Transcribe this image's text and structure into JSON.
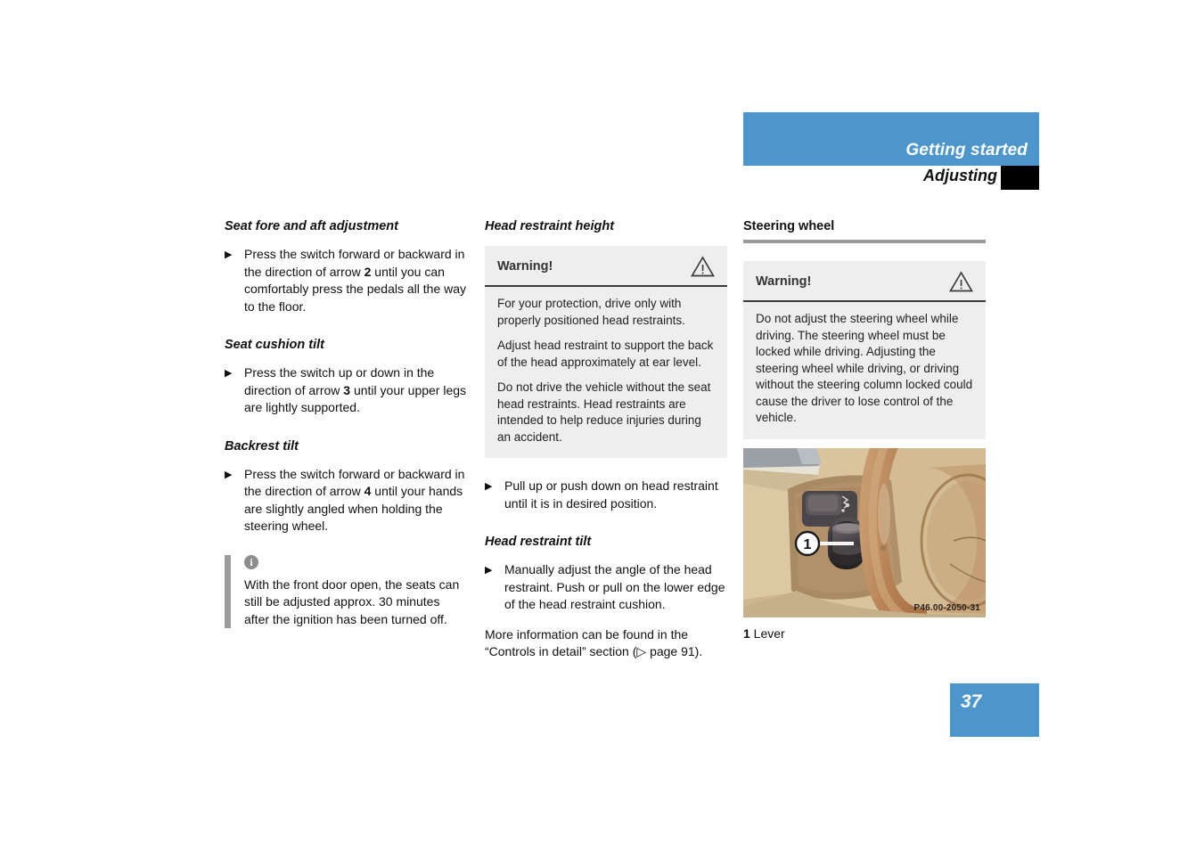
{
  "header": {
    "section_title": "Getting started",
    "subsection_title": "Adjusting"
  },
  "page_number": "37",
  "columns": {
    "left": {
      "heading_1": "Seat fore and aft adjustment",
      "bullet_1_pre": "Press the switch forward or backward in the direction of arrow ",
      "bullet_1_bold": "2",
      "bullet_1_post": " until you can comfortably press the pedals all the way to the floor.",
      "heading_2": "Seat cushion tilt",
      "bullet_2_pre": "Press the switch up or down in the direction of arrow ",
      "bullet_2_bold": "3",
      "bullet_2_post": " until your upper legs are lightly supported.",
      "heading_3": "Backrest tilt",
      "bullet_3_pre": "Press the switch forward or backward in the direction of arrow ",
      "bullet_3_bold": "4",
      "bullet_3_post": " until your hands are slightly angled when holding the steering wheel.",
      "note_icon": "info-icon",
      "note_text": "With the front door open, the seats can still be adjusted approx. 30 minutes after the ignition has been turned off."
    },
    "middle": {
      "heading_1": "Head restraint height",
      "warning": {
        "title": "Warning!",
        "icon": "warning-triangle-icon",
        "paragraph_1": "For your protection, drive only with properly positioned head restraints.",
        "paragraph_2": "Adjust head restraint to support the back of the head approximately at ear level.",
        "paragraph_3": "Do not drive the vehicle without the seat head restraints. Head restraints are intended to help reduce injuries during an accident."
      },
      "bullet_1": "Pull up or push down on head restraint until it is in desired position.",
      "heading_2": "Head restraint tilt",
      "bullet_2": "Manually adjust the angle of the head restraint. Push or pull on the lower edge of the head restraint cushion.",
      "closing_pre": "More information can be found in the “Controls in detail” section (",
      "closing_glyph": "▷",
      "closing_post": " page 91)."
    },
    "right": {
      "heading_1": "Steering wheel",
      "warning": {
        "title": "Warning!",
        "icon": "warning-triangle-icon",
        "paragraph_1": "Do not adjust the steering wheel while driving. The steering wheel must be locked while driving. Adjusting the steering wheel while driving, or driving without the steering column locked could cause the driver to lose control of the vehicle."
      },
      "illustration": {
        "name": "steering-column-lever-illustration",
        "callout_1": "1",
        "image_code": "P46.00-2050-31"
      },
      "legend_number": "1",
      "legend_label": " Lever"
    }
  },
  "colors": {
    "accent_blue": "#4d96cc",
    "warning_bg": "#eeeeee",
    "rule_gray": "#9b9b9b",
    "tab_black": "#000000"
  }
}
